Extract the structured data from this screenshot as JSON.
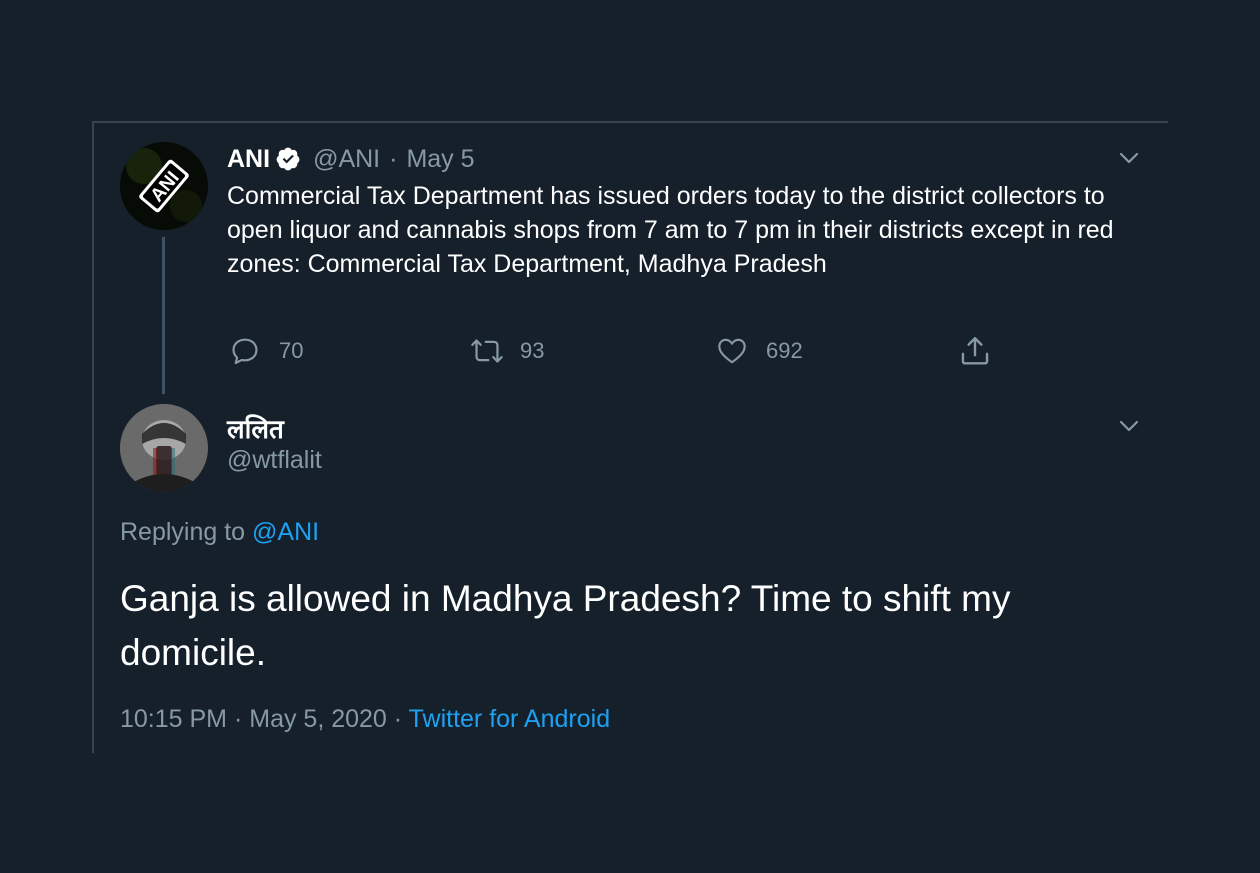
{
  "quoted_tweet": {
    "author_name": "ANI",
    "verified": true,
    "handle": "@ANI",
    "separator": "·",
    "date": "May 5",
    "text": "Commercial Tax Department has issued orders today to the district collectors to open liquor and cannabis shops from 7 am to 7 pm in their districts except in red zones: Commercial Tax Department, Madhya Pradesh",
    "avatar_label": "ANI",
    "actions": {
      "replies": "70",
      "retweets": "93",
      "likes": "692"
    }
  },
  "reply_tweet": {
    "author_name": "ललित",
    "handle": "@wtflalit",
    "replying_prefix": "Replying to",
    "replying_to": "@ANI",
    "text": "Ganja is allowed in Madhya Pradesh? Time to shift my domicile.",
    "time": "10:15 PM",
    "separator": "·",
    "date": "May 5, 2020",
    "source": "Twitter for Android"
  },
  "colors": {
    "background": "#15202b",
    "text": "#ffffff",
    "muted": "#8899a6",
    "link": "#1da1f2"
  },
  "icons": {
    "verified": "verified-badge-icon",
    "more": "chevron-down-icon",
    "reply": "comment-bubble-icon",
    "retweet": "retweet-arrows-icon",
    "like": "heart-outline-icon",
    "share": "share-upload-icon"
  }
}
